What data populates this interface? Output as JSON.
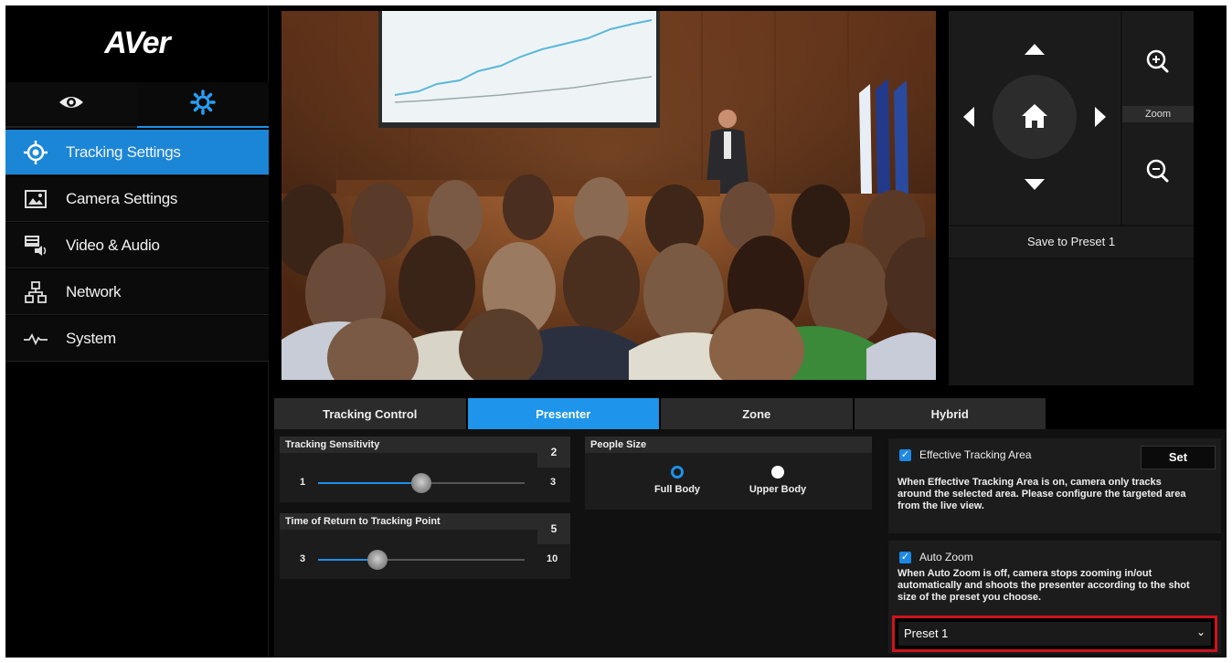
{
  "app": {
    "logo": "AVer"
  },
  "sidebar": {
    "mode_tabs": [
      {
        "icon": "eye-icon",
        "active": false
      },
      {
        "icon": "gear-icon",
        "active": true
      }
    ],
    "items": [
      {
        "label": "Tracking Settings",
        "icon": "crosshair-icon",
        "active": true
      },
      {
        "label": "Camera Settings",
        "icon": "image-icon",
        "active": false
      },
      {
        "label": "Video & Audio",
        "icon": "video-audio-icon",
        "active": false
      },
      {
        "label": "Network",
        "icon": "network-icon",
        "active": false
      },
      {
        "label": "System",
        "icon": "pulse-icon",
        "active": false
      }
    ]
  },
  "ptz": {
    "zoom_label": "Zoom",
    "save_preset": "Save to Preset 1"
  },
  "tabs": [
    {
      "label": "Tracking Control",
      "active": false
    },
    {
      "label": "Presenter",
      "active": true
    },
    {
      "label": "Zone",
      "active": false
    },
    {
      "label": "Hybrid",
      "active": false
    }
  ],
  "tracking_sensitivity": {
    "title": "Tracking Sensitivity",
    "value": "2",
    "min": "1",
    "max": "3",
    "level": 2
  },
  "return_time": {
    "title": "Time of Return to Tracking Point",
    "value": "5",
    "min": "3",
    "max": "10",
    "level": 5
  },
  "people_size": {
    "title": "People Size",
    "options": [
      {
        "label": "Full Body",
        "selected": true
      },
      {
        "label": "Upper Body",
        "selected": false
      }
    ]
  },
  "effective_area": {
    "title": "Effective Tracking Area",
    "checked": true,
    "button": "Set",
    "desc_lines": [
      "When Effective Tracking Area is on, camera only tracks",
      "around the selected area. Please configure the targeted area",
      "from the live view."
    ]
  },
  "auto_zoom": {
    "title": "Auto Zoom",
    "checked": true,
    "desc_lines": [
      "When Auto Zoom is off, camera stops zooming in/out",
      "automatically and shoots the presenter according to the shot",
      "size of the preset you choose."
    ],
    "preset_value": "Preset 1"
  },
  "colors": {
    "accent": "#1e90e6",
    "highlight": "#d0121c",
    "background": "#000000"
  }
}
